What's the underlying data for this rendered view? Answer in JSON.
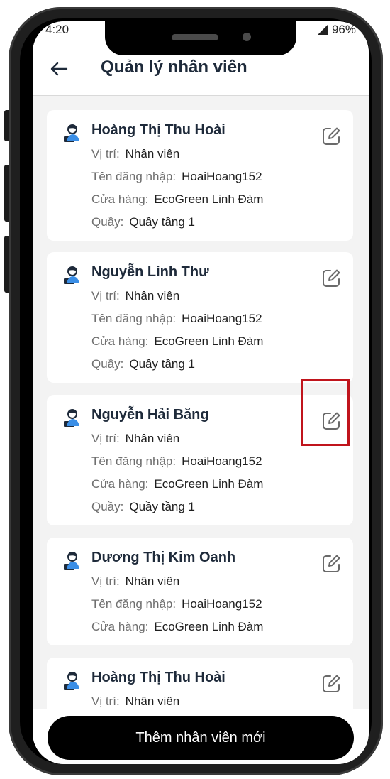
{
  "status_bar": {
    "time": "4:20",
    "battery": "96%"
  },
  "header": {
    "title": "Quản lý nhân viên"
  },
  "labels": {
    "position": "Vị trí:",
    "username": "Tên đăng nhập:",
    "store": "Cửa hàng:",
    "counter": "Quầy:"
  },
  "employees": [
    {
      "name": "Hoàng Thị Thu Hoài",
      "position": "Nhân viên",
      "username": "HoaiHoang152",
      "store": "EcoGreen Linh Đàm",
      "counter": "Quầy tầng 1"
    },
    {
      "name": "Nguyễn Linh Thư",
      "position": "Nhân viên",
      "username": "HoaiHoang152",
      "store": "EcoGreen Linh Đàm",
      "counter": "Quầy tầng 1"
    },
    {
      "name": "Nguyễn Hải Băng",
      "position": "Nhân viên",
      "username": "HoaiHoang152",
      "store": "EcoGreen Linh Đàm",
      "counter": "Quầy tầng 1"
    },
    {
      "name": "Dương Thị Kim Oanh",
      "position": "Nhân viên",
      "username": "HoaiHoang152",
      "store": "EcoGreen Linh Đàm"
    },
    {
      "name": "Hoàng Thị Thu Hoài",
      "position": "Nhân viên"
    }
  ],
  "footer": {
    "add_button": "Thêm nhân viên mới"
  },
  "colors": {
    "highlight": "#c0141c",
    "title": "#1e2a3a"
  }
}
